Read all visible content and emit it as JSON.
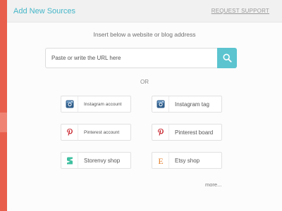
{
  "header": {
    "title": "Add New Sources",
    "request_support": "REQUEST SUPPORT"
  },
  "form": {
    "instruction": "Insert below a website or blog address",
    "url_placeholder": "Paste or write the URL here",
    "url_value": "",
    "or_label": "OR"
  },
  "sources": {
    "instagram_account": {
      "label": "Instagram account",
      "icon": "instagram-icon"
    },
    "instagram_tag": {
      "label": "Instagram tag",
      "icon": "instagram-icon"
    },
    "pinterest_account": {
      "label": "Pinterest account",
      "icon": "pinterest-icon"
    },
    "pinterest_board": {
      "label": "Pinterest board",
      "icon": "pinterest-icon"
    },
    "storenvy_shop": {
      "label": "Storenvy shop",
      "icon": "storenvy-icon"
    },
    "etsy_shop": {
      "label": "Etsy shop",
      "icon": "etsy-icon"
    }
  },
  "more_label": "more...",
  "colors": {
    "accent": "#45b6c8",
    "search_button": "#5bc4cf",
    "sidebar": "#e8604c",
    "instagram": "#2f5d8a",
    "pinterest": "#c8232c",
    "storenvy": "#3fc0a0",
    "etsy": "#e07b25"
  }
}
